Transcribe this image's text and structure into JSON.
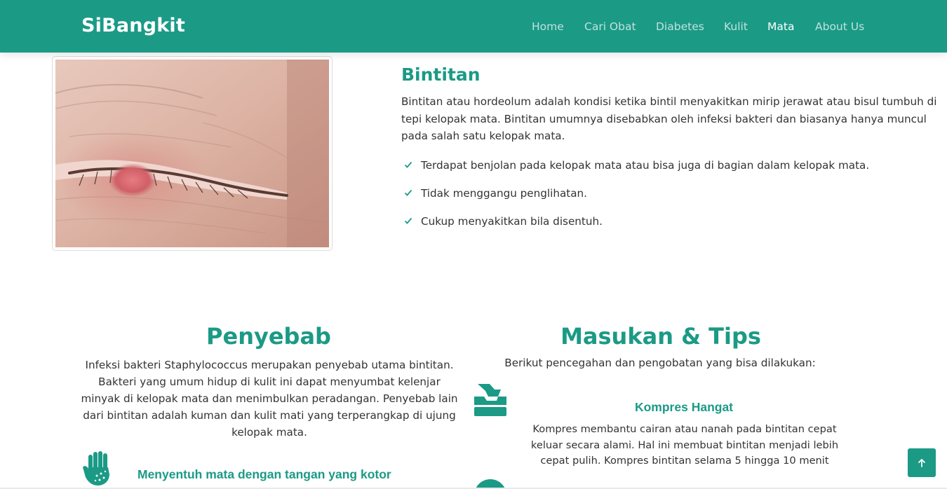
{
  "nav": {
    "brand": "SiBangkit",
    "items": [
      {
        "label": "Home",
        "active": false
      },
      {
        "label": "Cari Obat",
        "active": false
      },
      {
        "label": "Diabetes",
        "active": false
      },
      {
        "label": "Kulit",
        "active": false
      },
      {
        "label": "Mata",
        "active": true
      },
      {
        "label": "About Us",
        "active": false
      }
    ]
  },
  "disease": {
    "image_icon": "eye-stye-photo",
    "title": "Bintitan",
    "description": "Bintitan atau hordeolum adalah kondisi ketika bintil menyakitkan mirip jerawat atau bisul tumbuh di tepi kelopak mata. Bintitan umumnya disebabkan oleh infeksi bakteri dan biasanya hanya muncul pada salah satu kelopak mata.",
    "symptoms": [
      "Terdapat benjolan pada kelopak mata atau bisa juga di bagian dalam kelopak mata.",
      "Tidak menggangu penglihatan.",
      "Cukup menyakitkan bila disentuh."
    ]
  },
  "causes": {
    "title": "Penyebab",
    "description": "Infeksi bakteri Staphylococcus merupakan penyebab utama bintitan. Bakteri yang umum hidup di kulit ini dapat menyumbat kelenjar minyak di kelopak mata dan menimbulkan peradangan. Penyebab lain dari bintitan adalah kuman dan kulit mati yang terperangkap di ujung kelopak mata.",
    "items": [
      {
        "icon": "dirty-hand-icon",
        "title": "Menyentuh mata dengan tangan yang kotor"
      }
    ]
  },
  "tips": {
    "title": "Masukan & Tips",
    "intro": "Berikut pencegahan dan pengobatan yang bisa dilakukan:",
    "items": [
      {
        "icon": "tissue-box-icon",
        "title": "Kompres Hangat",
        "description": "Kompres membantu cairan atau nanah pada bintitan cepat keluar secara alami. Hal ini membuat bintitan menjadi lebih cepat pulih. Kompres bintitan selama 5 hingga 10 menit"
      }
    ]
  },
  "back_to_top_icon": "arrow-up-icon",
  "colors": {
    "primary": "#1b9a86",
    "text": "#333333",
    "nav_inactive": "rgba(255,255,255,0.72)"
  }
}
